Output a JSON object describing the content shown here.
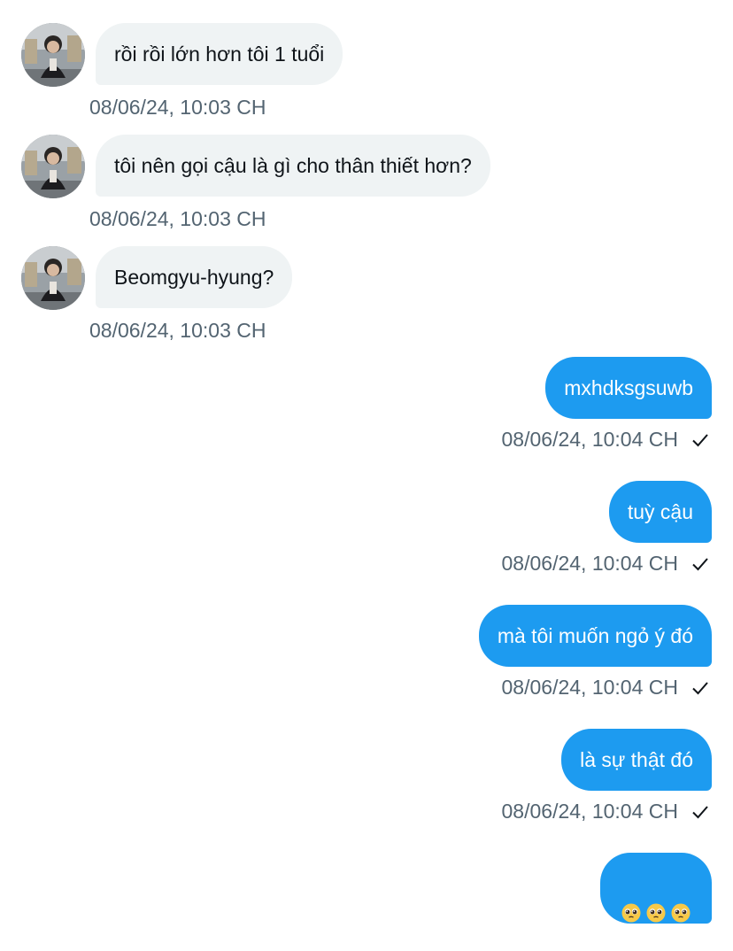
{
  "incoming": [
    {
      "text": "rồi rồi lớn hơn tôi 1 tuổi",
      "time": "08/06/24, 10:03 CH"
    },
    {
      "text": "tôi nên gọi cậu là gì cho thân thiết hơn?",
      "time": "08/06/24, 10:03 CH"
    },
    {
      "text": "Beomgyu-hyung?",
      "time": "08/06/24, 10:03 CH"
    }
  ],
  "outgoing": [
    {
      "text": "mxhdksgsuwb",
      "time": "08/06/24, 10:04 CH",
      "status": "sent"
    },
    {
      "text": "tuỳ cậu",
      "time": "08/06/24, 10:04 CH",
      "status": "sent"
    },
    {
      "text": "mà tôi muốn ngỏ ý đó",
      "time": "08/06/24, 10:04 CH",
      "status": "sent"
    },
    {
      "text": "là sự thật đó",
      "time": "08/06/24, 10:04 CH",
      "status": "sent"
    },
    {
      "text": "🥺🥺🥺",
      "emoji_icons": [
        "pleading-face-icon",
        "pleading-face-icon",
        "pleading-face-icon"
      ]
    }
  ],
  "colors": {
    "incoming_bubble": "#eff3f4",
    "outgoing_bubble": "#1d9bf0",
    "timestamp": "#536471",
    "text_dark": "#0f1419"
  }
}
